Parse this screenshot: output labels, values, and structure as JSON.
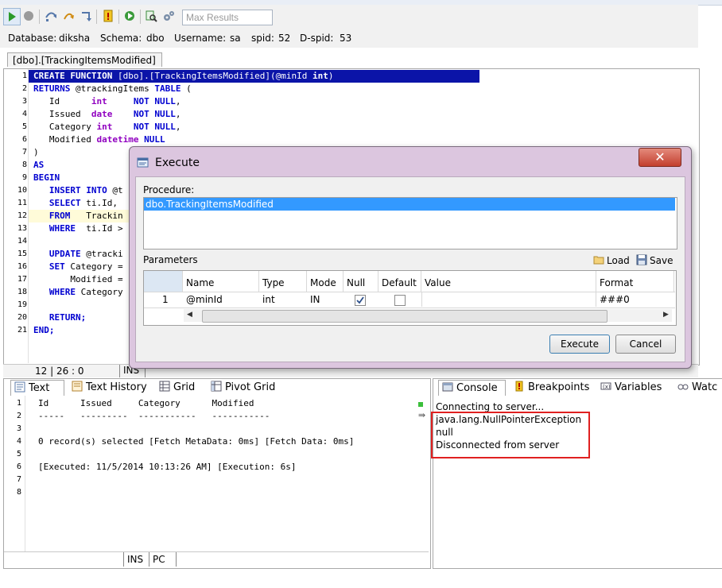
{
  "toolbar": {
    "max_results_placeholder": "Max Results"
  },
  "connection": {
    "database_label": "Database:",
    "database": "diksha",
    "schema_label": "Schema:",
    "schema": "dbo",
    "username_label": "Username:",
    "username": "sa",
    "spid_label": "spid:",
    "spid": "52",
    "dspid_label": "D-spid:",
    "dspid": "53"
  },
  "editor": {
    "tab_title": "[dbo].[TrackingItemsModified]",
    "line_numbers": [
      "1",
      "2",
      "3",
      "4",
      "5",
      "6",
      "7",
      "8",
      "9",
      "10",
      "11",
      "12",
      "13",
      "14",
      "15",
      "16",
      "17",
      "18",
      "19",
      "20",
      "21"
    ],
    "code": {
      "l1_kw1": "CREATE FUNCTION",
      "l1_rest": " [dbo].[TrackingItemsModified](@minId ",
      "l1_ty": "int",
      "l1_end": ")",
      "l2_kw": "RETURNS",
      "l2_mid": " @trackingItems ",
      "l2_kw2": "TABLE",
      "l2_end": " (",
      "l3_name": "   Id      ",
      "l3_ty": "int",
      "l3_pad": "     ",
      "l3_kw": "NOT NULL",
      "l3_end": ",",
      "l4_name": "   Issued  ",
      "l4_ty": "date",
      "l4_pad": "    ",
      "l4_kw": "NOT NULL",
      "l4_end": ",",
      "l5_name": "   Category ",
      "l5_ty": "int",
      "l5_pad": "    ",
      "l5_kw": "NOT NULL",
      "l5_end": ",",
      "l6_name": "   Modified ",
      "l6_ty": "datetime",
      "l6_pad": " ",
      "l6_kw": "NULL",
      "l7": ")",
      "l8_kw": "AS",
      "l9_kw": "BEGIN",
      "l10_kw": "   INSERT INTO",
      "l10_rest": " @t",
      "l11_kw": "   SELECT",
      "l11_rest": " ti.Id,",
      "l12_kw": "   FROM",
      "l12_rest": "   Trackin",
      "l13_kw": "   WHERE",
      "l13_rest": "  ti.Id >",
      "l15_kw": "   UPDATE",
      "l15_rest": " @tracki",
      "l16_kw": "   SET",
      "l16_rest": " Category =",
      "l17_rest": "       Modified =",
      "l18_kw": "   WHERE",
      "l18_rest": " Category",
      "l20_kw": "   RETURN;",
      "l21_kw": "END;"
    },
    "status": {
      "position": "12 | 26 : 0",
      "mode": "INS"
    }
  },
  "results": {
    "tabs": [
      "Text",
      "Text History",
      "Grid",
      "Pivot Grid"
    ],
    "line_numbers": [
      "1",
      "2",
      "3",
      "4",
      "5",
      "6",
      "7",
      "8"
    ],
    "lines": [
      "Id      Issued     Category      Modified",
      "-----   ---------  -----------   -----------",
      "",
      "0 record(s) selected [Fetch MetaData: 0ms] [Fetch Data: 0ms]",
      "",
      "[Executed: 11/5/2014 10:13:26 AM] [Execution: 6s]",
      "",
      ""
    ],
    "status_ins": "INS",
    "status_pc": "PC"
  },
  "console": {
    "tabs": [
      "Console",
      "Breakpoints",
      "Variables",
      "Watc"
    ],
    "lines": [
      "Connecting to server...",
      "java.lang.NullPointerException",
      "null",
      "Disconnected from server"
    ]
  },
  "dialog": {
    "title": "Execute",
    "procedure_label": "Procedure:",
    "procedure_selected": "dbo.TrackingItemsModified",
    "parameters_label": "Parameters",
    "load_label": "Load",
    "save_label": "Save",
    "grid_headers": [
      "Name",
      "Type",
      "Mode",
      "Null",
      "Default",
      "Value",
      "Format"
    ],
    "grid_row": {
      "index": "1",
      "name": "@minId",
      "type": "int",
      "mode": "IN",
      "null_checked": true,
      "default_checked": false,
      "value": "",
      "format": "###0"
    },
    "execute_label": "Execute",
    "cancel_label": "Cancel"
  },
  "colors": {
    "selection_line": "#0b14a8",
    "keyword": "#0000d0",
    "type": "#9000c0",
    "highlight_box": "#e02020",
    "dialog_frame": "#dcc6df",
    "selected_item": "#3399ff"
  }
}
